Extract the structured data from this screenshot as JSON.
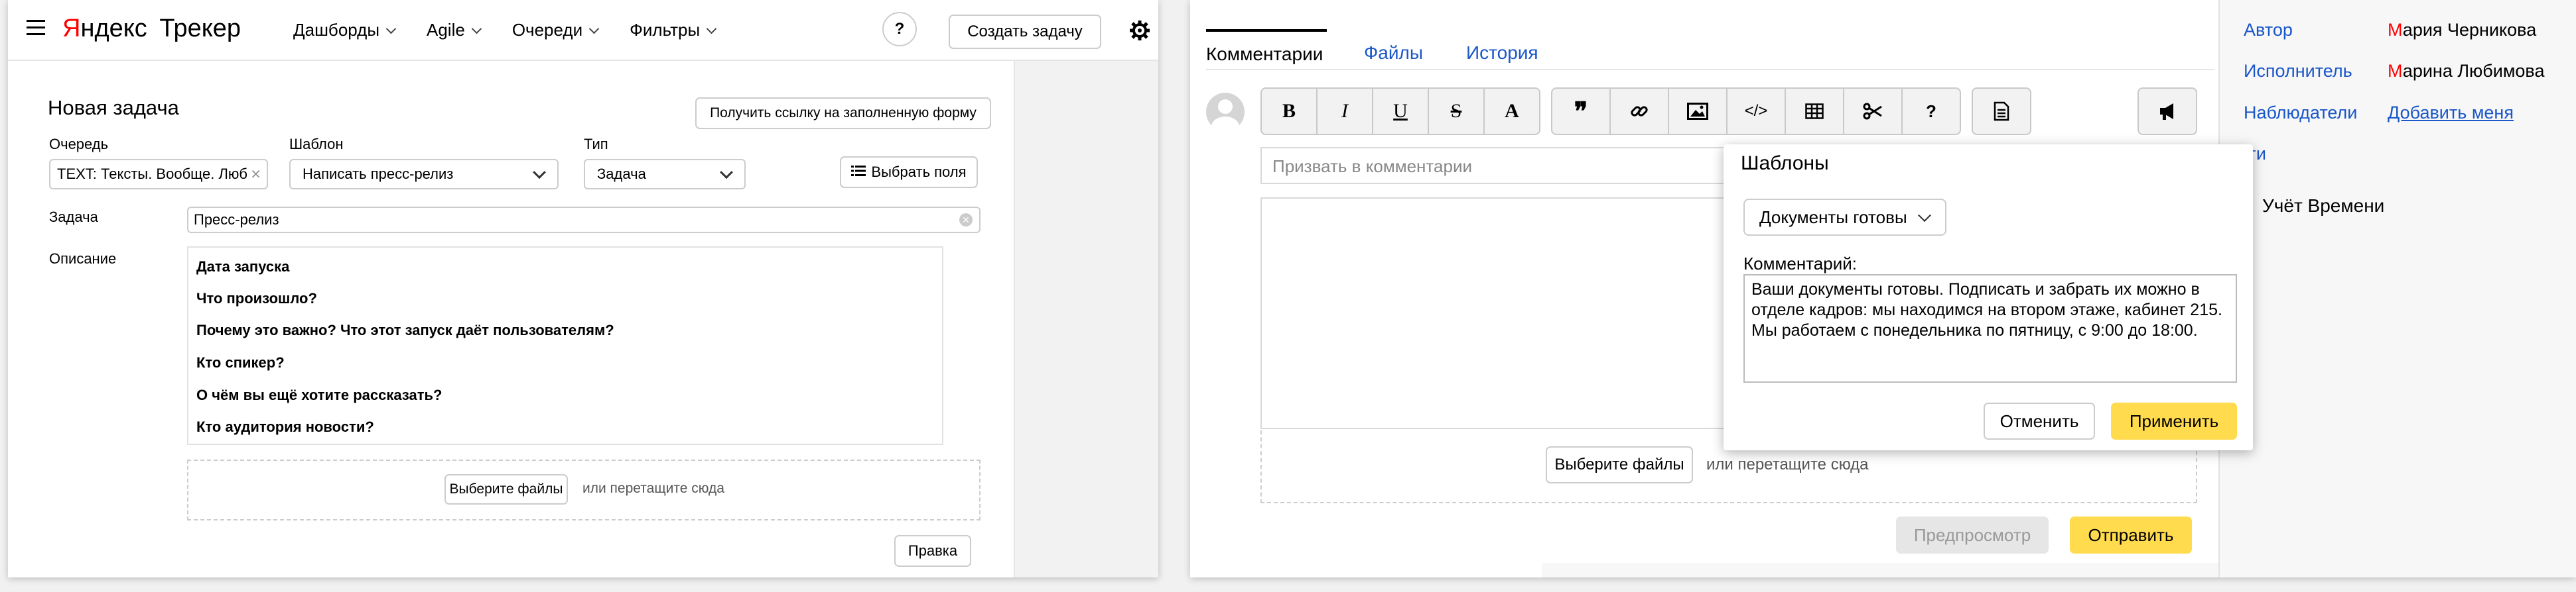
{
  "header": {
    "logo_ya": "Я",
    "logo_rest": "ндекс",
    "product": "Трекер",
    "nav": [
      {
        "label": "Дашборды"
      },
      {
        "label": "Agile"
      },
      {
        "label": "Очереди"
      },
      {
        "label": "Фильтры"
      }
    ],
    "help": "?",
    "create_button": "Создать задачу"
  },
  "form": {
    "title": "Новая задача",
    "get_link_button": "Получить ссылку на заполненную форму",
    "queue_label": "Очередь",
    "queue_value": "TEXT: Тексты. Вообще. Люб",
    "template_label": "Шаблон",
    "template_value": "Написать пресс-релиз",
    "type_label": "Тип",
    "type_value": "Задача",
    "choose_fields_button": "Выбрать поля",
    "task_label": "Задача",
    "task_value": "Пресс-релиз",
    "description_label": "Описание",
    "description_lines": [
      "Дата запуска",
      "Что произошло?",
      "Почему это важно? Что этот запуск даёт пользователям?",
      "Кто спикер?",
      "О чём вы ещё хотите рассказать?",
      "Кто аудитория новости?"
    ],
    "choose_files_button": "Выберите файлы",
    "drop_hint": "или перетащите сюда",
    "edit_button": "Правка"
  },
  "comments": {
    "tabs": [
      {
        "label": "Комментарии",
        "active": true
      },
      {
        "label": "Файлы",
        "active": false
      },
      {
        "label": "История",
        "active": false
      }
    ],
    "toolbar": [
      "B",
      "I",
      "U",
      "S",
      "A",
      "❞",
      "link-icon",
      "image-icon",
      "</>",
      "table-icon",
      "scissors-icon",
      "?",
      "document-icon",
      "megaphone-icon"
    ],
    "summon_placeholder": "Призвать в комментарии",
    "choose_files_button": "Выберите файлы",
    "drop_hint": "или перетащите сюда",
    "preview_button": "Предпросмотр",
    "send_button": "Отправить"
  },
  "templates_popup": {
    "title": "Шаблоны",
    "selected_template": "Документы готовы",
    "comment_label": "Комментарий:",
    "comment_text": "Ваши документы готовы. Подписать и забрать их можно в отделе кадров: мы находимся на втором этаже, кабинет 215. Мы работаем с понедельника по пятницу, с 9:00 до 18:00.",
    "cancel_button": "Отменить",
    "apply_button": "Применить"
  },
  "sidebar": {
    "author_label": "Автор",
    "author_initial": "М",
    "author_rest": "ария Черникова",
    "assignee_label": "Исполнитель",
    "assignee_initial": "М",
    "assignee_rest": "арина Любимова",
    "followers_label": "Наблюдатели",
    "add_me_link": "Добавить меня",
    "tags_label_visible": "еги",
    "time_tracking": "Учёт Времени"
  },
  "colors": {
    "accent_yellow": "#ffdb4d",
    "link_blue": "#1a57c9",
    "logo_red": "#f00"
  }
}
